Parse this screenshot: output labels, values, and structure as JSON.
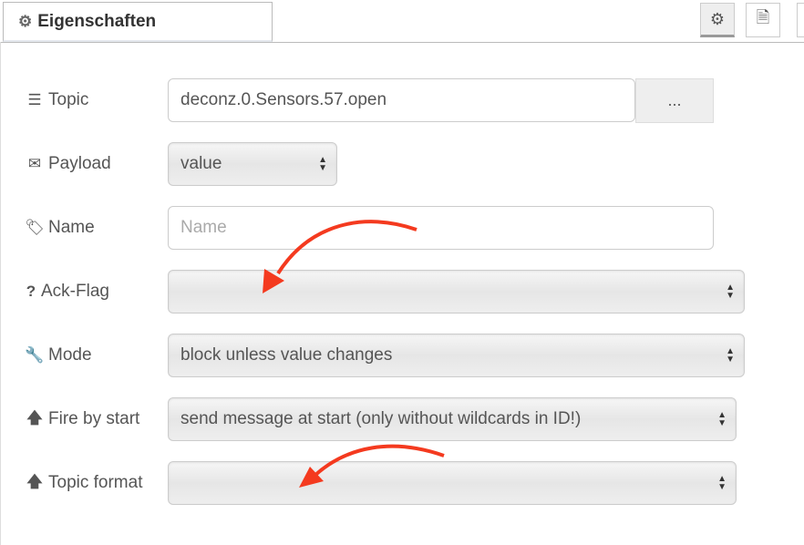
{
  "tabs": {
    "active_label": "Eigenschaften",
    "icon": "gear-icon",
    "right_buttons": [
      {
        "icon": "gear-icon"
      },
      {
        "icon": "document-icon"
      },
      {
        "icon": "node-icon"
      }
    ]
  },
  "form": {
    "topic": {
      "label": "Topic",
      "icon": "server-icon",
      "value": "deconz.0.Sensors.57.open",
      "browse_label": "..."
    },
    "payload": {
      "label": "Payload",
      "icon": "envelope-icon",
      "value": "value"
    },
    "name": {
      "label": "Name",
      "icon": "tag-icon",
      "value": "",
      "placeholder": "Name"
    },
    "ack_flag": {
      "label": "Ack-Flag",
      "icon": "question-icon",
      "value": ""
    },
    "mode": {
      "label": "Mode",
      "icon": "wrench-icon",
      "value": "block unless value changes"
    },
    "fire_by_start": {
      "label": "Fire by start",
      "icon": "arrow-up-icon",
      "value": "send message at start (only without wildcards in ID!)"
    },
    "topic_format": {
      "label": "Topic format",
      "icon": "arrow-up-icon",
      "value": ""
    }
  },
  "annotation_color": "#f43a1f"
}
